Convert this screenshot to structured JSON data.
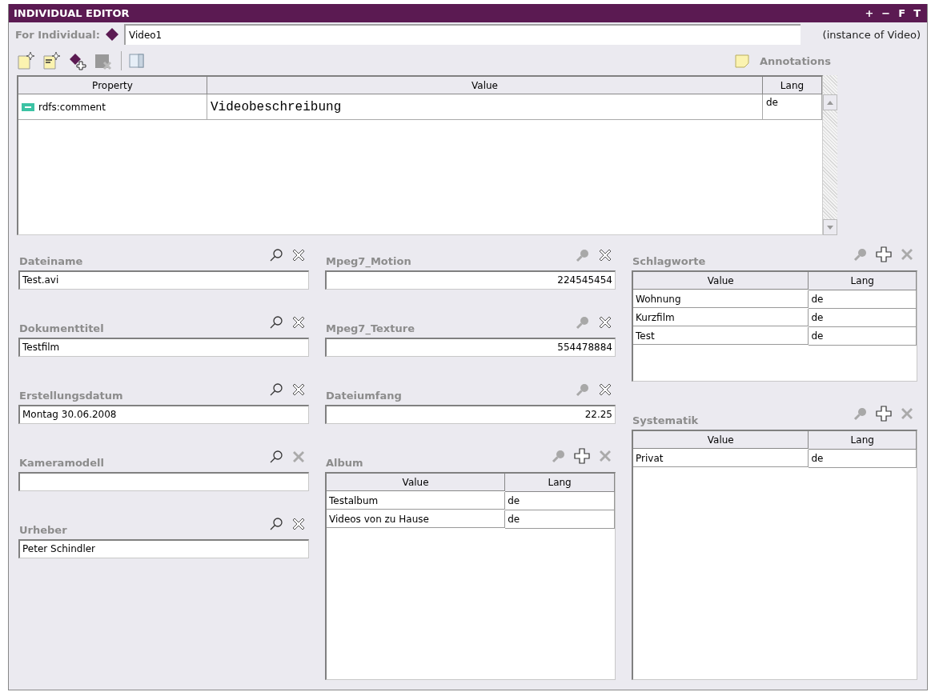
{
  "window": {
    "title": "INDIVIDUAL EDITOR",
    "title_buttons": [
      "+",
      "−",
      "F",
      "T"
    ]
  },
  "individual": {
    "label": "For Individual:",
    "value": "Video1",
    "type_note": "(instance of Video)"
  },
  "annotations_label": "Annotations",
  "property_table": {
    "columns": [
      "Property",
      "Value",
      "Lang"
    ],
    "rows": [
      {
        "property": "rdfs:comment",
        "value": "Videobeschreibung",
        "lang": "de"
      }
    ]
  },
  "columns": [
    [
      {
        "kind": "field",
        "label": "Dateiname",
        "value": "Test.avi",
        "numeric": false,
        "find_enabled": true,
        "delete_enabled": true
      },
      {
        "kind": "field",
        "label": "Dokumenttitel",
        "value": "Testfilm",
        "numeric": false,
        "find_enabled": true,
        "delete_enabled": true
      },
      {
        "kind": "field",
        "label": "Erstellungsdatum",
        "value": "Montag 30.06.2008",
        "numeric": false,
        "find_enabled": true,
        "delete_enabled": true
      },
      {
        "kind": "field",
        "label": "Kameramodell",
        "numeric": false,
        "find_enabled": true,
        "delete_enabled": false
      },
      {
        "kind": "field",
        "label": "Urheber",
        "value": "Peter Schindler",
        "numeric": false,
        "find_enabled": true,
        "delete_enabled": true
      }
    ],
    [
      {
        "kind": "field",
        "label": "Mpeg7_Motion",
        "value": "224545454",
        "numeric": true,
        "find_enabled": false,
        "delete_enabled": true
      },
      {
        "kind": "field",
        "label": "Mpeg7_Texture",
        "value": "554478884",
        "numeric": true,
        "find_enabled": false,
        "delete_enabled": true
      },
      {
        "kind": "field",
        "label": "Dateiumfang",
        "value": "22.25",
        "numeric": true,
        "find_enabled": false,
        "delete_enabled": true
      },
      {
        "kind": "table",
        "label": "Album",
        "find_enabled": false,
        "add_enabled": true,
        "delete_enabled": false,
        "columns": [
          "Value",
          "Lang"
        ],
        "rows": [
          {
            "value": "Testalbum",
            "lang": "de"
          },
          {
            "value": "Videos von zu Hause",
            "lang": "de"
          }
        ]
      }
    ],
    [
      {
        "kind": "table",
        "label": "Schlagworte",
        "find_enabled": false,
        "add_enabled": true,
        "delete_enabled": false,
        "columns": [
          "Value",
          "Lang"
        ],
        "rows": [
          {
            "value": "Wohnung",
            "lang": "de"
          },
          {
            "value": "Kurzfilm",
            "lang": "de"
          },
          {
            "value": "Test",
            "lang": "de"
          }
        ]
      },
      {
        "kind": "table",
        "label": "Systematik",
        "find_enabled": false,
        "add_enabled": true,
        "delete_enabled": false,
        "columns": [
          "Value",
          "Lang"
        ],
        "rows": [
          {
            "value": "Privat",
            "lang": "de"
          }
        ]
      }
    ]
  ]
}
